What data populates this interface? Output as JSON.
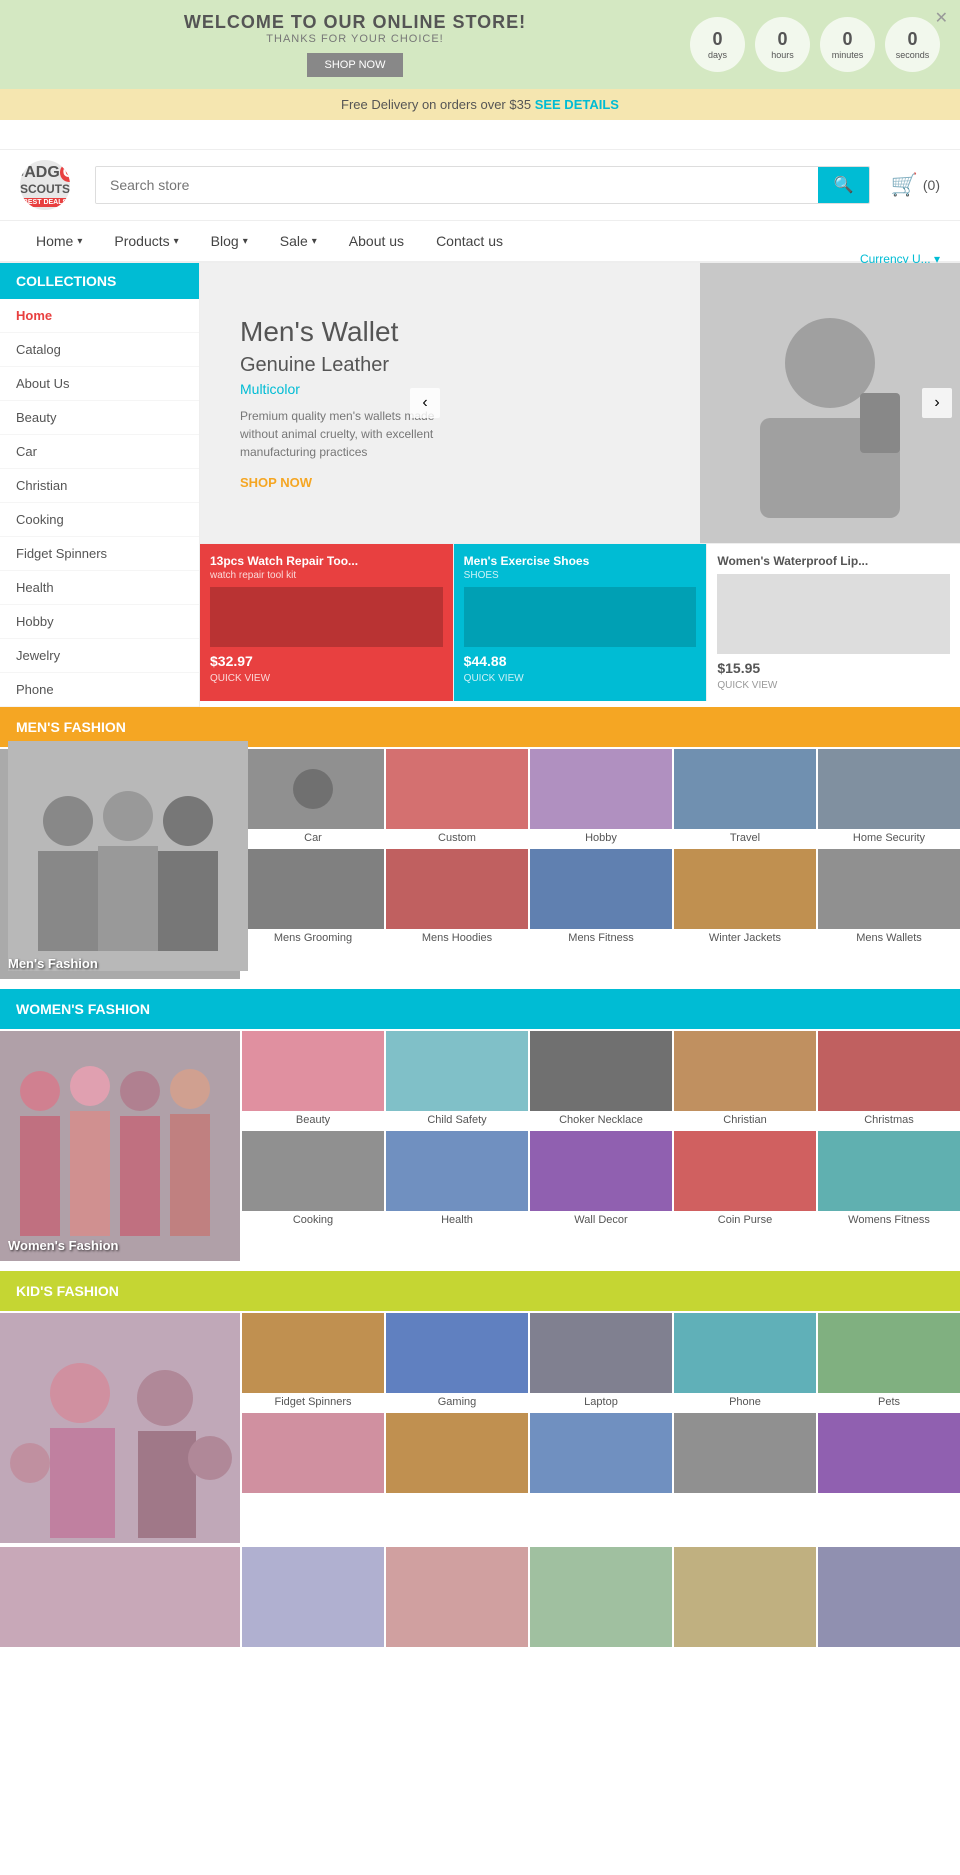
{
  "banner": {
    "title": "WELCOME TO OUR ONLINE STORE!",
    "subtitle": "THANKS FOR YOUR CHOICE!",
    "shop_now": "SHOP NOW",
    "close": "✕",
    "countdown": [
      {
        "value": "0",
        "label": "days"
      },
      {
        "value": "0",
        "label": "hours"
      },
      {
        "value": "0",
        "label": "minutes"
      },
      {
        "value": "0",
        "label": "seconds"
      }
    ]
  },
  "delivery_bar": {
    "text": "Free Delivery on orders over $35",
    "link_text": "SEE DETAILS"
  },
  "header": {
    "currency": "Currency U...",
    "logo_text_1": "GADG",
    "logo_text_2": "SCOUTS",
    "logo_badge": "BEST DEALS",
    "search_placeholder": "Search store",
    "cart_count": "(0)"
  },
  "nav": {
    "items": [
      {
        "label": "Home",
        "has_dropdown": true
      },
      {
        "label": "Products",
        "has_dropdown": true
      },
      {
        "label": "Blog",
        "has_dropdown": true
      },
      {
        "label": "Sale",
        "has_dropdown": true
      },
      {
        "label": "About us",
        "has_dropdown": false
      },
      {
        "label": "Contact us",
        "has_dropdown": false
      }
    ]
  },
  "sidebar": {
    "title": "Collections",
    "items": [
      {
        "label": "Home",
        "active": true
      },
      {
        "label": "Catalog"
      },
      {
        "label": "About Us"
      },
      {
        "label": "Beauty"
      },
      {
        "label": "Car"
      },
      {
        "label": "Christian"
      },
      {
        "label": "Cooking"
      },
      {
        "label": "Fidget Spinners"
      },
      {
        "label": "Health"
      },
      {
        "label": "Hobby"
      },
      {
        "label": "Jewelry"
      },
      {
        "label": "Phone"
      }
    ]
  },
  "hero": {
    "title": "Men's Wallet",
    "subtitle": "Genuine Leather",
    "color": "Multicolor",
    "description": "Premium quality men's wallets made without animal cruelty, with excellent manufacturing practices",
    "shop_now": "SHOP NOW"
  },
  "product_strip": [
    {
      "label": "13pcs Watch Repair Too...",
      "sub": "watch repair tool kit",
      "price": "$32.97",
      "quick": "QUICK VIEW",
      "special": true
    },
    {
      "label": "Men's Exercise Shoes",
      "sub": "SHOES",
      "price": "$44.88",
      "quick": "QUICK VIEW",
      "special": false
    },
    {
      "label": "Women's Waterproof Lip...",
      "sub": "",
      "price": "$15.95",
      "quick": "QUICK VIEW",
      "special": false
    }
  ],
  "mens_fashion": {
    "section_title": "Men's Fashion",
    "main_label": "Men's Fashion",
    "top_categories": [
      {
        "label": "Car",
        "color": "ov-gray"
      },
      {
        "label": "Custom",
        "color": "ov-red"
      },
      {
        "label": "Hobby",
        "color": "ov-purple"
      },
      {
        "label": "Travel",
        "color": "ov-blue"
      },
      {
        "label": "Home Security",
        "color": "ov-dark"
      }
    ],
    "bottom_categories": [
      {
        "label": "Mens Grooming",
        "color": "ov-dark"
      },
      {
        "label": "Mens Hoodies",
        "color": "ov-red"
      },
      {
        "label": "Mens Fitness",
        "color": "ov-blue"
      },
      {
        "label": "Winter Jackets",
        "color": "ov-orange"
      },
      {
        "label": "Mens Wallets",
        "color": "ov-gray"
      }
    ]
  },
  "womens_fashion": {
    "section_title": "Women's Fashion",
    "main_label": "Women's Fashion",
    "top_categories": [
      {
        "label": "Beauty",
        "color": "ov-pink"
      },
      {
        "label": "Child Safety",
        "color": "ov-teal"
      },
      {
        "label": "Choker Necklace",
        "color": "ov-dark"
      },
      {
        "label": "Christian",
        "color": "ov-orange"
      },
      {
        "label": "Christmas",
        "color": "ov-red"
      }
    ],
    "bottom_categories": [
      {
        "label": "Cooking",
        "color": "ov-gray"
      },
      {
        "label": "Health",
        "color": "ov-blue"
      },
      {
        "label": "Wall Decor",
        "color": "ov-purple"
      },
      {
        "label": "Coin Purse",
        "color": "ov-red"
      },
      {
        "label": "Womens Fitness",
        "color": "ov-teal"
      }
    ]
  },
  "kids_fashion": {
    "section_title": "Kid's Fashion",
    "top_categories": [
      {
        "label": "Fidget Spinners",
        "color": "ov-orange"
      },
      {
        "label": "Gaming",
        "color": "ov-blue"
      },
      {
        "label": "Laptop",
        "color": "ov-gray"
      },
      {
        "label": "Phone",
        "color": "ov-teal"
      },
      {
        "label": "Pets",
        "color": "ov-green"
      }
    ],
    "bottom_categories": [
      {
        "label": "",
        "color": "ov-pink"
      },
      {
        "label": "",
        "color": "ov-orange"
      },
      {
        "label": "",
        "color": "ov-blue"
      },
      {
        "label": "",
        "color": "ov-gray"
      },
      {
        "label": "",
        "color": "ov-purple"
      }
    ]
  }
}
